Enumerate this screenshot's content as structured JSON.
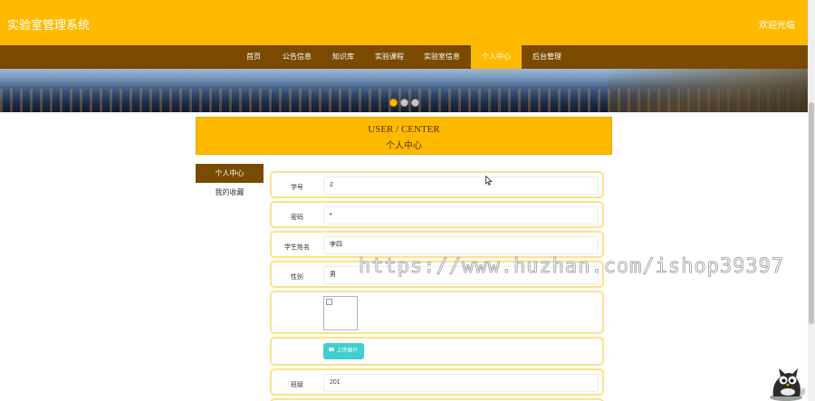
{
  "header": {
    "site_title": "实验室管理系统",
    "welcome": "欢迎光临"
  },
  "nav": {
    "items": [
      {
        "label": "首页"
      },
      {
        "label": "公告信息"
      },
      {
        "label": "知识库"
      },
      {
        "label": "实验课程"
      },
      {
        "label": "实验室信息"
      },
      {
        "label": "个人中心"
      },
      {
        "label": "后台管理"
      }
    ],
    "active_index": 5
  },
  "banner": {
    "slide_count": 3,
    "active_slide": 0
  },
  "section_title": {
    "en": "USER / CENTER",
    "zh": "个人中心"
  },
  "sidebar": {
    "items": [
      {
        "label": "个人中心"
      },
      {
        "label": "我的收藏"
      }
    ],
    "active_index": 0
  },
  "form": {
    "student_no": {
      "label": "学号",
      "value": "2"
    },
    "password": {
      "label": "密码",
      "value": "•"
    },
    "student_name": {
      "label": "学生姓名",
      "value": "李四"
    },
    "gender": {
      "label": "性别",
      "value": "男"
    },
    "upload_button": "上传图片",
    "class_field": {
      "label": "班级",
      "value": "201"
    }
  },
  "watermark": {
    "text": "https://www.huzhan.com/ishop39397"
  },
  "colors": {
    "primary": "#ffba00",
    "nav_bg": "#7a4a00",
    "row_border": "#ffe08a",
    "upload_button": "#3fcfcf"
  },
  "icons": {
    "cursor": "arrow-cursor-icon",
    "mascot": "cartoon-owl-icon",
    "upload": "cloud-upload-icon"
  }
}
